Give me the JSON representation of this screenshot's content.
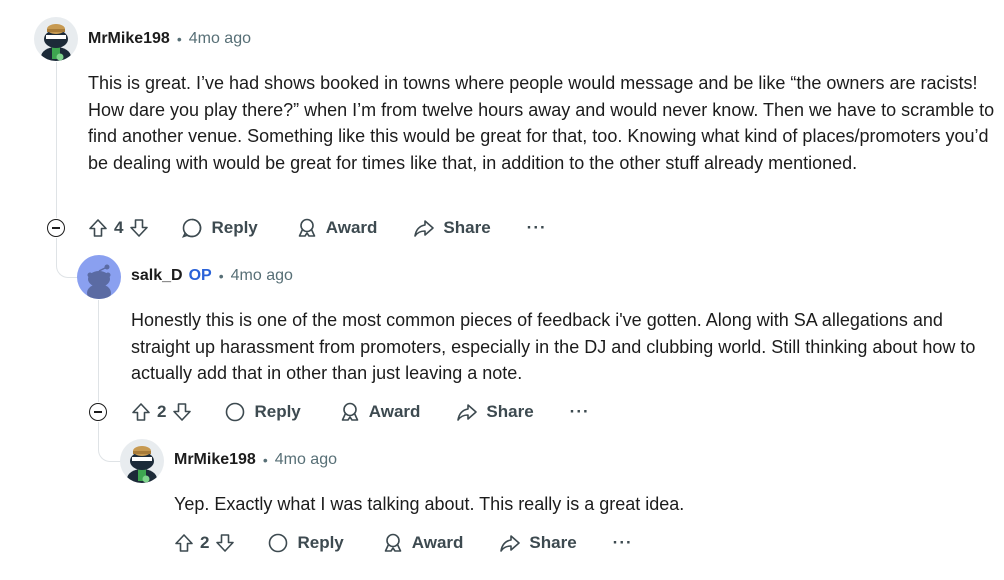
{
  "comments": [
    {
      "author": "MrMike198",
      "op_badge": "",
      "time": "4mo ago",
      "body": "This is great. I’ve had shows booked in towns where people would message and be like “the owners are racists! How dare you play there?” when I’m from twelve hours away and would never know. Then we have to scramble to find another venue. Something like this would be great for that, too. Knowing what kind of places/promoters you’d be dealing with would be great for times like that, in addition to the other stuff already mentioned.",
      "votes": "4",
      "avatar": "snoo-cap-icon"
    },
    {
      "author": "salk_D",
      "op_badge": "OP",
      "time": "4mo ago",
      "body": "Honestly this is one of the most common pieces of feedback i've gotten. Along with SA allegations and straight up harassment from promoters, especially in the DJ and clubbing world. Still thinking about how to actually add that in other than just leaving a note.",
      "votes": "2",
      "avatar": "default-snoo-icon"
    },
    {
      "author": "MrMike198",
      "op_badge": "",
      "time": "4mo ago",
      "body": "Yep. Exactly what I was talking about. This really is a great idea.",
      "votes": "2",
      "avatar": "snoo-cap-icon"
    }
  ],
  "actions": {
    "reply": "Reply",
    "award": "Award",
    "share": "Share",
    "more": "···"
  },
  "colors": {
    "text": "#1c1c1c",
    "muted": "#576f76",
    "op": "#2a62d8",
    "thread_line": "#dfe3e6",
    "default_avatar_bg": "#8aa0f0"
  }
}
